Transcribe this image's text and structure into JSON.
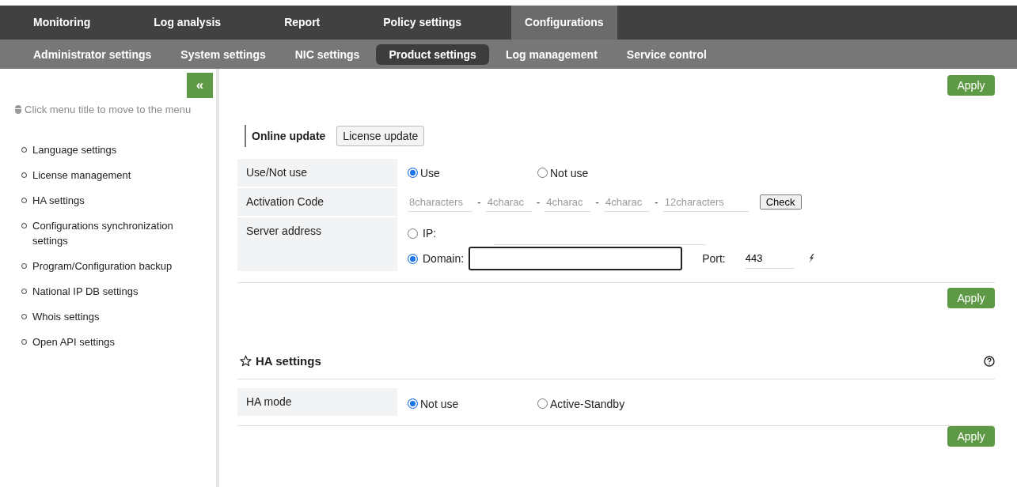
{
  "top_nav": [
    {
      "label": "Monitoring",
      "selected": false
    },
    {
      "label": "Log analysis",
      "selected": false
    },
    {
      "label": "Report",
      "selected": false
    },
    {
      "label": "Policy settings",
      "selected": false
    },
    {
      "label": "Configurations",
      "selected": true
    }
  ],
  "sub_nav": [
    {
      "label": "Administrator settings",
      "selected": false
    },
    {
      "label": "System settings",
      "selected": false
    },
    {
      "label": "NIC settings",
      "selected": false
    },
    {
      "label": "Product settings",
      "selected": true
    },
    {
      "label": "Log management",
      "selected": false
    },
    {
      "label": "Service control",
      "selected": false
    }
  ],
  "sidebar": {
    "collapse_button": "«",
    "hint": "Click menu title to move to the menu",
    "items": [
      {
        "label": "Language settings"
      },
      {
        "label": "License management"
      },
      {
        "label": "HA settings"
      },
      {
        "label": "Configurations synchronization settings"
      },
      {
        "label": "Program/Configuration backup"
      },
      {
        "label": "National IP DB settings"
      },
      {
        "label": "Whois settings"
      },
      {
        "label": "Open API settings"
      }
    ]
  },
  "apply_top": "Apply",
  "update_tabs": [
    {
      "label": "Online update",
      "selected": true
    },
    {
      "label": "License update",
      "selected": false
    }
  ],
  "use_row": {
    "label": "Use/Not use",
    "options": [
      {
        "label": "Use",
        "selected": true
      },
      {
        "label": "Not use",
        "selected": false
      }
    ]
  },
  "activation_row": {
    "label": "Activation Code",
    "fields": [
      {
        "placeholder": "8characters"
      },
      {
        "placeholder": "4charac"
      },
      {
        "placeholder": "4charac"
      },
      {
        "placeholder": "4charac"
      },
      {
        "placeholder": "12characters"
      }
    ],
    "separator": "-",
    "check_button": "Check"
  },
  "server_row": {
    "label": "Server address",
    "ip": {
      "label": "IP:",
      "selected": false
    },
    "domain": {
      "label": "Domain:",
      "selected": true
    },
    "port_label": "Port:",
    "port_value": "443"
  },
  "apply_mid": "Apply",
  "ha": {
    "title": "HA settings",
    "mode_row": {
      "label": "HA mode",
      "options": [
        {
          "label": "Not use",
          "selected": true
        },
        {
          "label": "Active-Standby",
          "selected": false
        }
      ]
    },
    "apply": "Apply"
  }
}
